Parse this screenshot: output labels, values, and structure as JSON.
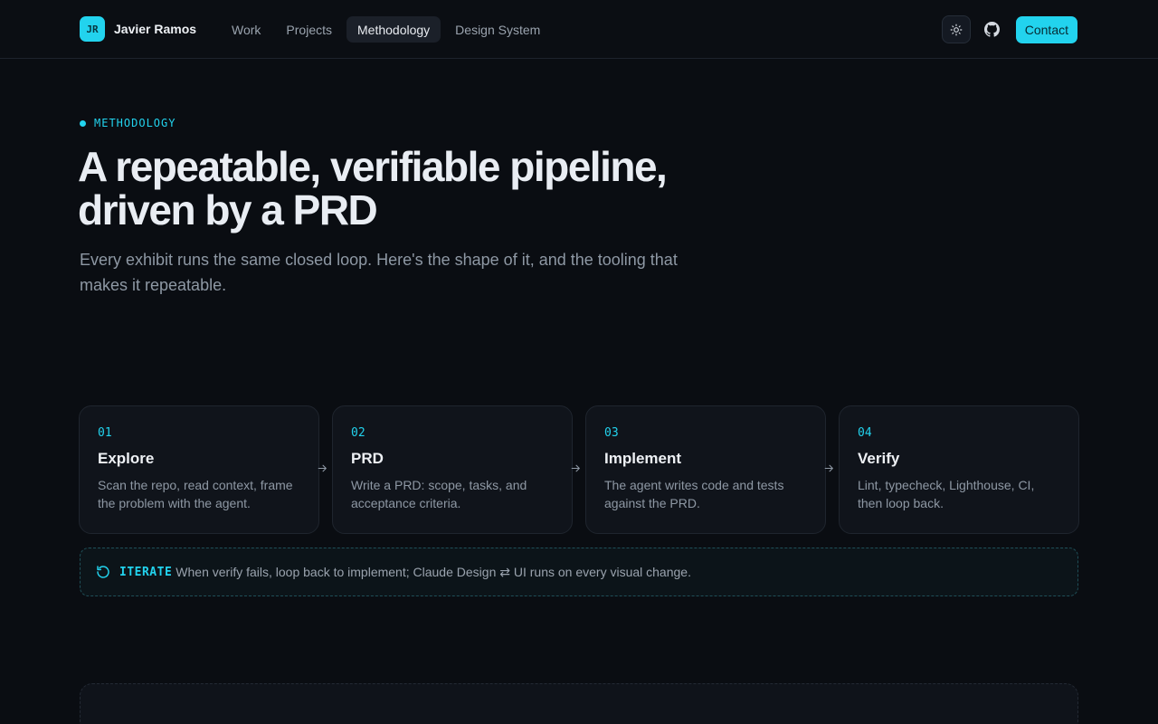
{
  "brand": {
    "initials": "JR",
    "name": "Javier Ramos"
  },
  "nav": [
    {
      "label": "Work",
      "active": false
    },
    {
      "label": "Projects",
      "active": false
    },
    {
      "label": "Methodology",
      "active": true
    },
    {
      "label": "Design System",
      "active": false
    }
  ],
  "header_actions": {
    "theme_icon": "sun-icon",
    "github_icon": "github-icon",
    "contact_label": "Contact"
  },
  "hero": {
    "eyebrow": "METHODOLOGY",
    "title_line1": "A repeatable, verifiable pipeline,",
    "title_line2": "driven by a PRD",
    "subtitle": "Every exhibit runs the same closed loop. Here's the shape of it, and the tooling that makes it repeatable."
  },
  "steps": [
    {
      "number": "01",
      "title": "Explore",
      "description": "Scan the repo, read context, frame the problem with the agent."
    },
    {
      "number": "02",
      "title": "PRD",
      "description": "Write a PRD: scope, tasks, and acceptance criteria."
    },
    {
      "number": "03",
      "title": "Implement",
      "description": "The agent writes code and tests against the PRD."
    },
    {
      "number": "04",
      "title": "Verify",
      "description": "Lint, typecheck, Lighthouse, CI, then loop back."
    }
  ],
  "iterate": {
    "label": "ITERATE",
    "text": "When verify fails, loop back to implement; Claude Design ⇄ UI runs on every visual change."
  },
  "colors": {
    "accent": "#22d3ee",
    "background": "#0a0d12",
    "card": "#10141b"
  }
}
